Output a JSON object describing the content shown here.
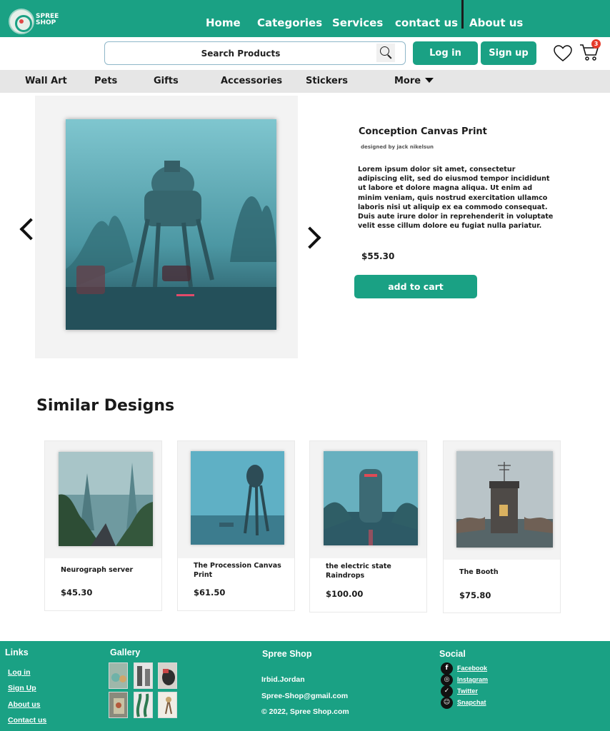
{
  "header": {
    "brand": "SPREE SHOP",
    "nav": [
      "Home",
      "Categories",
      "Services",
      "contact us",
      "About us"
    ],
    "search_placeholder": "Search Products",
    "login_label": "Log in",
    "signup_label": "Sign up",
    "cart_count": "3",
    "accent": "#1aa184"
  },
  "categories": [
    "Wall Art",
    "Pets",
    "Gifts",
    "Accessories",
    "Stickers",
    "More"
  ],
  "product": {
    "title": "Conception Canvas Print",
    "designer": "designed by jack nikelsun",
    "description": "Lorem ipsum dolor sit amet, consectetur adipiscing elit, sed do eiusmod tempor incididunt ut labore et dolore magna aliqua. Ut enim ad minim veniam, quis nostrud exercitation ullamco laboris nisi ut aliquip ex ea commodo consequat. Duis aute irure dolor in reprehenderit in voluptate velit esse cillum dolore eu fugiat nulla pariatur.",
    "price": "$55.30",
    "add_to_cart": "add to cart"
  },
  "similar": {
    "heading": "Similar Designs",
    "items": [
      {
        "name": "Neurograph server",
        "price": "$45.30"
      },
      {
        "name": "The Procession Canvas Print",
        "price": "$61.50"
      },
      {
        "name": "the electric state Raindrops",
        "price": "$100.00"
      },
      {
        "name": "The Booth",
        "price": "$75.80"
      }
    ]
  },
  "footer": {
    "links_heading": "Links",
    "links": [
      "Log in",
      "Sign Up",
      "About us",
      "Contact us"
    ],
    "gallery_heading": "Gallery",
    "shop_heading": "Spree Shop",
    "shop_lines": [
      "Irbid.Jordan",
      "Spree-Shop@gmail.com",
      "© 2022, Spree Shop.com"
    ],
    "social_heading": "Social",
    "social": [
      "Facebook",
      "Instagram",
      "Twitter",
      "Snapchat"
    ]
  }
}
